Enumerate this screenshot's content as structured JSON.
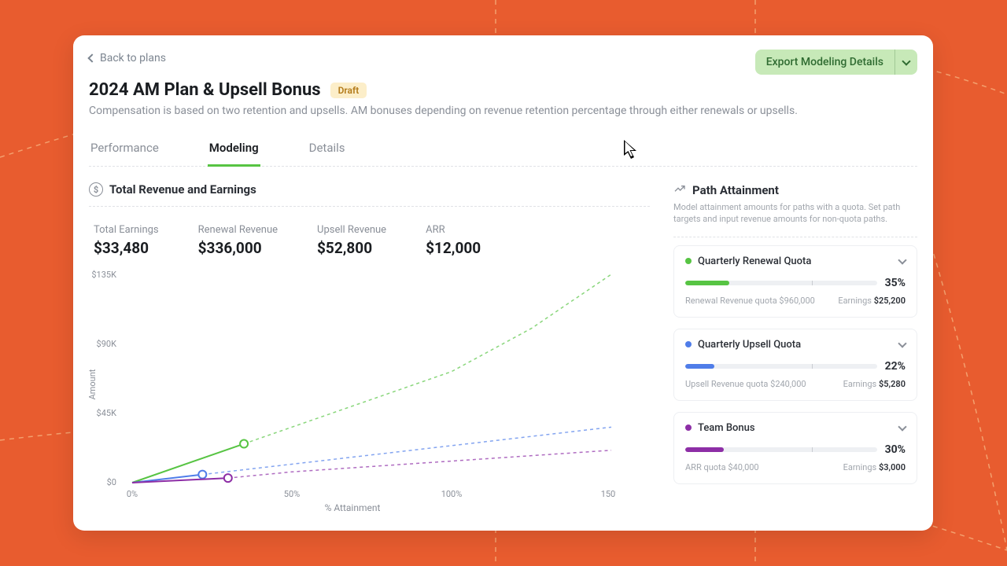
{
  "header": {
    "back_label": "Back to plans",
    "export_label": "Export Modeling Details",
    "title": "2024 AM Plan & Upsell Bonus",
    "badge": "Draft",
    "subtitle": "Compensation is based on two retention and upsells. AM bonuses depending on revenue retention percentage through either renewals or upsells."
  },
  "tabs": {
    "performance": "Performance",
    "modeling": "Modeling",
    "details": "Details"
  },
  "revenue_panel": {
    "title": "Total Revenue and Earnings",
    "stats": {
      "total_earnings_label": "Total Earnings",
      "total_earnings_value": "$33,480",
      "renewal_label": "Renewal Revenue",
      "renewal_value": "$336,000",
      "upsell_label": "Upsell Revenue",
      "upsell_value": "$52,800",
      "arr_label": "ARR",
      "arr_value": "$12,000"
    }
  },
  "chart_ticks": {
    "y0": "$0",
    "y45": "$45K",
    "y90": "$90K",
    "y135": "$135K",
    "x0": "0%",
    "x50": "50%",
    "x100": "100%",
    "x150": "150%",
    "xlabel": "% Attainment",
    "ylabel": "Amount"
  },
  "path_panel": {
    "title": "Path Attainment",
    "subtitle": "Model attainment amounts for paths with a quota. Set path targets and input revenue amounts for non-quota paths."
  },
  "paths": {
    "renewal": {
      "title": "Quarterly Renewal Quota",
      "pct": "35%",
      "quota_line": "Renewal Revenue quota $960,000",
      "earn_label": "Earnings",
      "earn_value": "$25,200",
      "color": "#57c443",
      "fill_pct": 23
    },
    "upsell": {
      "title": "Quarterly Upsell Quota",
      "pct": "22%",
      "quota_line": "Upsell Revenue quota $240,000",
      "earn_label": "Earnings",
      "earn_value": "$5,280",
      "color": "#4f7de9",
      "fill_pct": 15
    },
    "team": {
      "title": "Team Bonus",
      "pct": "30%",
      "quota_line": "ARR quota $40,000",
      "earn_label": "Earnings",
      "earn_value": "$3,000",
      "color": "#8d2ea6",
      "fill_pct": 20
    }
  },
  "chart_data": {
    "type": "line",
    "xlabel": "% Attainment",
    "ylabel": "Amount",
    "xlim": [
      0,
      150
    ],
    "ylim": [
      0,
      135000
    ],
    "x": [
      0,
      25,
      50,
      75,
      100,
      125,
      150
    ],
    "series": [
      {
        "name": "Quarterly Renewal Quota",
        "color": "#57c443",
        "values": [
          0,
          18000,
          36000,
          54000,
          72000,
          100000,
          135000
        ],
        "marker_at_x": 35,
        "marker_y": 25200
      },
      {
        "name": "Quarterly Upsell Quota",
        "color": "#4f7de9",
        "values": [
          0,
          6000,
          12000,
          18000,
          24000,
          30000,
          36000
        ],
        "marker_at_x": 22,
        "marker_y": 5280
      },
      {
        "name": "Team Bonus",
        "color": "#8d2ea6",
        "values": [
          0,
          3500,
          7000,
          10500,
          14000,
          17500,
          21000
        ],
        "marker_at_x": 30,
        "marker_y": 3000
      }
    ]
  }
}
